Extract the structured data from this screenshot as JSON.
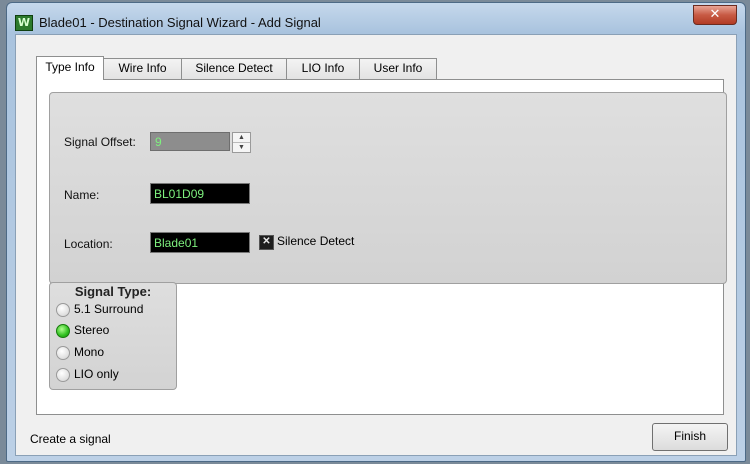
{
  "window": {
    "title": "Blade01 - Destination Signal Wizard - Add Signal",
    "app_icon_glyph": "W",
    "close_glyph": "✕"
  },
  "tabs": [
    {
      "label": "Type Info",
      "active": true
    },
    {
      "label": "Wire Info",
      "active": false
    },
    {
      "label": "Silence Detect",
      "active": false
    },
    {
      "label": "LIO Info",
      "active": false
    },
    {
      "label": "User Info",
      "active": false
    }
  ],
  "form": {
    "signal_offset_label": "Signal Offset:",
    "signal_offset_value": "9",
    "name_label": "Name:",
    "name_value": "BL01D09",
    "location_label": "Location:",
    "location_value": "Blade01",
    "silence_detect_label": "Silence Detect",
    "silence_detect_checked": true
  },
  "signal_type": {
    "title": "Signal Type:",
    "options": [
      {
        "label": "5.1 Surround",
        "selected": false
      },
      {
        "label": "Stereo",
        "selected": true
      },
      {
        "label": "Mono",
        "selected": false
      },
      {
        "label": "LIO only",
        "selected": false
      }
    ]
  },
  "footer": {
    "status": "Create a signal",
    "finish_label": "Finish"
  },
  "colors": {
    "field_text": "#7ef07e",
    "radio_selected": "#2fbf1f",
    "close_button": "#c75a44"
  }
}
